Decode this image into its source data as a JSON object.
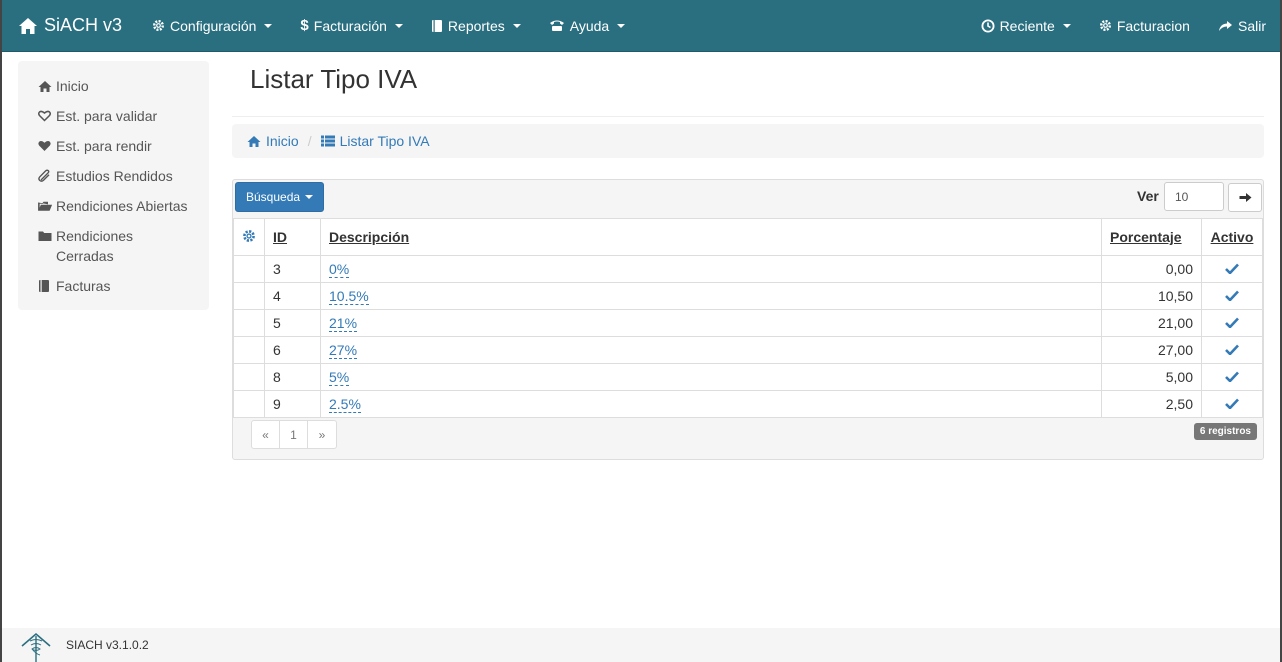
{
  "navbar": {
    "brand": "SiACH v3",
    "menus": [
      {
        "label": "Configuración"
      },
      {
        "label": "Facturación"
      },
      {
        "label": "Reportes"
      },
      {
        "label": "Ayuda"
      }
    ],
    "right": [
      {
        "label": "Reciente"
      },
      {
        "label": "Facturacion"
      },
      {
        "label": "Salir"
      }
    ]
  },
  "sidebar": {
    "items": [
      {
        "label": "Inicio",
        "icon": "home-icon"
      },
      {
        "label": "Est. para validar",
        "icon": "heart-outline-icon"
      },
      {
        "label": "Est. para rendir",
        "icon": "heart-icon"
      },
      {
        "label": "Estudios Rendidos",
        "icon": "paperclip-icon"
      },
      {
        "label": "Rendiciones Abiertas",
        "icon": "folder-open-icon"
      },
      {
        "label": "Rendiciones Cerradas",
        "icon": "folder-icon"
      },
      {
        "label": "Facturas",
        "icon": "book-icon"
      }
    ]
  },
  "page": {
    "title": "Listar Tipo IVA",
    "breadcrumb": [
      {
        "label": "Inicio"
      },
      {
        "label": "Listar Tipo IVA"
      }
    ]
  },
  "toolbar": {
    "search_label": "Búsqueda",
    "ver_label": "Ver",
    "ver_value": "10"
  },
  "table": {
    "headers": {
      "id": "ID",
      "descripcion": "Descripción",
      "porcentaje": "Porcentaje",
      "activo": "Activo"
    },
    "rows": [
      {
        "id": "3",
        "descripcion": "0%",
        "porcentaje": "0,00",
        "activo": true
      },
      {
        "id": "4",
        "descripcion": "10.5%",
        "porcentaje": "10,50",
        "activo": true
      },
      {
        "id": "5",
        "descripcion": "21%",
        "porcentaje": "21,00",
        "activo": true
      },
      {
        "id": "6",
        "descripcion": "27%",
        "porcentaje": "27,00",
        "activo": true
      },
      {
        "id": "8",
        "descripcion": "5%",
        "porcentaje": "5,00",
        "activo": true
      },
      {
        "id": "9",
        "descripcion": "2.5%",
        "porcentaje": "2,50",
        "activo": true
      }
    ]
  },
  "pagination": {
    "prev": "«",
    "current": "1",
    "next": "»"
  },
  "records_badge": "6 registros",
  "footer": {
    "version": "SIACH v3.1.0.2"
  },
  "colors": {
    "navbar": "#2a6f80",
    "accent": "#337ab7",
    "badge": "#777777"
  }
}
